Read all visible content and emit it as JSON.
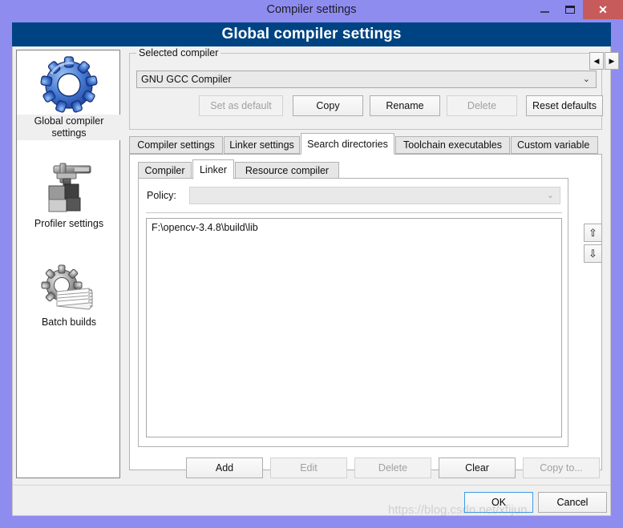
{
  "window": {
    "title": "Compiler settings",
    "banner": "Global compiler settings",
    "buttons": {
      "minimize": "–",
      "maximize": "☐",
      "close": "✕"
    }
  },
  "sidebar": {
    "items": [
      {
        "label": "Global compiler settings",
        "icon": "blue-gear-icon",
        "selected": true
      },
      {
        "label": "Profiler settings",
        "icon": "caliper-icon",
        "selected": false
      },
      {
        "label": "Batch builds",
        "icon": "gear-stack-icon",
        "selected": false
      }
    ]
  },
  "selected_compiler": {
    "group_title": "Selected compiler",
    "value": "GNU GCC Compiler",
    "caret": "⌄",
    "buttons": [
      {
        "label": "Set as default",
        "enabled": false
      },
      {
        "label": "Copy",
        "enabled": true
      },
      {
        "label": "Rename",
        "enabled": true
      },
      {
        "label": "Delete",
        "enabled": false
      },
      {
        "label": "Reset defaults",
        "enabled": true
      }
    ]
  },
  "tabs": {
    "items": [
      {
        "label": "Compiler settings",
        "active": false
      },
      {
        "label": "Linker settings",
        "active": false
      },
      {
        "label": "Search directories",
        "active": true
      },
      {
        "label": "Toolchain executables",
        "active": false
      },
      {
        "label": "Custom variable",
        "active": false
      }
    ],
    "scroll_left": "◀",
    "scroll_right": "▶"
  },
  "subtabs": {
    "items": [
      {
        "label": "Compiler",
        "active": false
      },
      {
        "label": "Linker",
        "active": true
      },
      {
        "label": "Resource compiler",
        "active": false
      }
    ]
  },
  "search_directories": {
    "policy_label": "Policy:",
    "policy_value": "",
    "policy_caret": "⌄",
    "entries": [
      "F:\\opencv-3.4.8\\build\\lib"
    ],
    "move_up": "⇧",
    "move_down": "⇩",
    "buttons": [
      {
        "label": "Add",
        "enabled": true
      },
      {
        "label": "Edit",
        "enabled": false
      },
      {
        "label": "Delete",
        "enabled": false
      },
      {
        "label": "Clear",
        "enabled": true
      },
      {
        "label": "Copy to...",
        "enabled": false
      }
    ]
  },
  "footer": {
    "ok": "OK",
    "cancel": "Cancel"
  },
  "watermark": "https://blog.csdn.net/xfijun",
  "colors": {
    "window_border": "#8f8cf0",
    "banner": "#004382",
    "close_button": "#c75b5b",
    "focus_outline": "#3d9ae8",
    "dialog_bg": "#f0f0f0"
  }
}
